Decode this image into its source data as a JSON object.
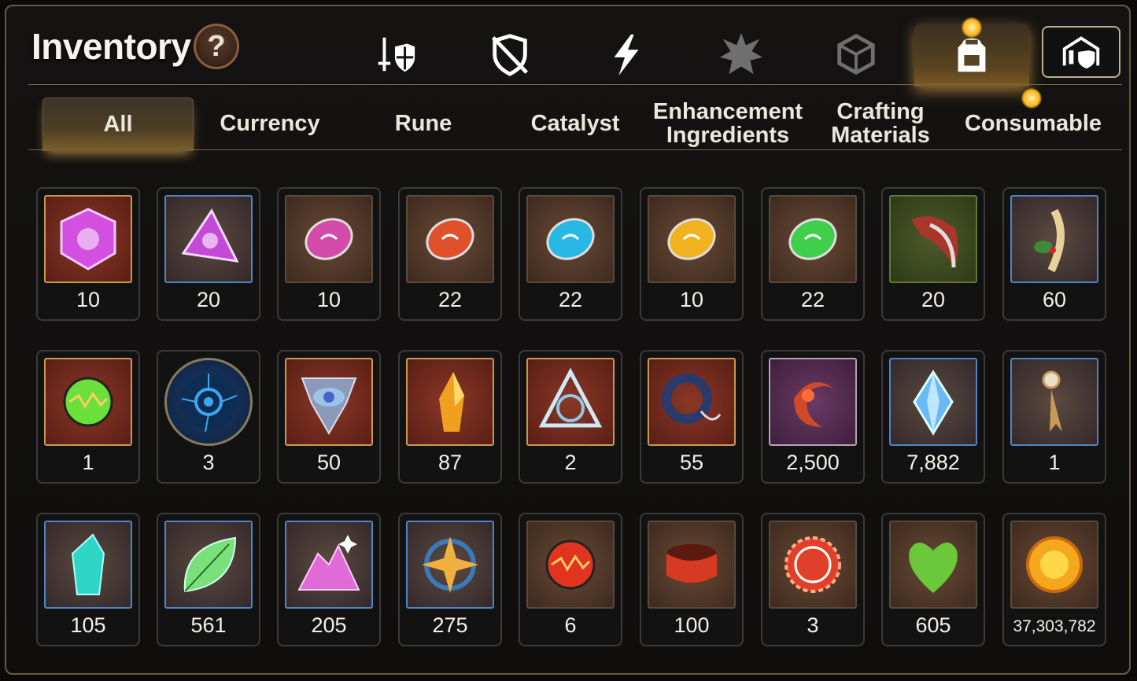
{
  "header": {
    "title": "Inventory",
    "help_label": "?"
  },
  "category_tabs": [
    {
      "name": "tab-equipment",
      "icon": "sword-shield-icon",
      "active": false
    },
    {
      "name": "tab-unequipped",
      "icon": "crossed-shield-icon",
      "active": false
    },
    {
      "name": "tab-skills",
      "icon": "lightning-icon",
      "active": false
    },
    {
      "name": "tab-spirits",
      "icon": "spiked-emblem-icon",
      "active": false
    },
    {
      "name": "tab-boxes",
      "icon": "cube-icon",
      "active": false
    },
    {
      "name": "tab-bag",
      "icon": "backpack-icon",
      "active": true
    }
  ],
  "castle_button": {
    "icon": "castle-shield-icon"
  },
  "sub_tabs": [
    {
      "label": "All",
      "active": true
    },
    {
      "label": "Currency",
      "active": false
    },
    {
      "label": "Rune",
      "active": false
    },
    {
      "label": "Catalyst",
      "active": false
    },
    {
      "label": "Enhancement\nIngredients",
      "active": false
    },
    {
      "label": "Crafting\nMaterials",
      "active": false
    },
    {
      "label": "Consumable",
      "active": false
    }
  ],
  "colors": {
    "accent_gold": "#c69a52",
    "notification": "#ffb21a",
    "frame": "#6b5a3f"
  },
  "items": [
    {
      "icon": "purple-hexagon-gem-icon",
      "quantity": "10",
      "frame": "red",
      "color": "#d24fe0"
    },
    {
      "icon": "purple-triangle-gem-icon",
      "quantity": "20",
      "frame": "blue",
      "color": "#c24ad6"
    },
    {
      "icon": "purple-oval-gem-icon",
      "quantity": "10",
      "frame": "brown",
      "color": "#d44aa8"
    },
    {
      "icon": "red-rune-stone-icon",
      "quantity": "22",
      "frame": "brown",
      "color": "#e0502a"
    },
    {
      "icon": "cyan-rune-stone-icon",
      "quantity": "22",
      "frame": "brown",
      "color": "#27b8e6"
    },
    {
      "icon": "yellow-rune-stone-icon",
      "quantity": "10",
      "frame": "brown",
      "color": "#f0b21e"
    },
    {
      "icon": "green-rune-stone-icon",
      "quantity": "22",
      "frame": "brown",
      "color": "#3fcf4a"
    },
    {
      "icon": "red-claw-icon",
      "quantity": "20",
      "frame": "green",
      "color": "#a8362a"
    },
    {
      "icon": "ginseng-root-icon",
      "quantity": "60",
      "frame": "blue",
      "color": "#e8d09a"
    },
    {
      "icon": "green-orb-icon",
      "quantity": "1",
      "frame": "red",
      "color": "#6ae03a"
    },
    {
      "icon": "blue-circuit-disc-icon",
      "quantity": "3",
      "frame": "round",
      "color": "#3aa8f0"
    },
    {
      "icon": "eye-emblem-icon",
      "quantity": "50",
      "frame": "red",
      "color": "#9fc3e8"
    },
    {
      "icon": "amber-crystal-icon",
      "quantity": "87",
      "frame": "red",
      "color": "#f0a020"
    },
    {
      "icon": "crystal-triquetra-icon",
      "quantity": "2",
      "frame": "red",
      "color": "#cfe8f5"
    },
    {
      "icon": "navy-amulet-icon",
      "quantity": "55",
      "frame": "red",
      "color": "#2a3a6a"
    },
    {
      "icon": "crescent-flower-icon",
      "quantity": "2,500",
      "frame": "purple",
      "color": "#d04a2a"
    },
    {
      "icon": "blue-diamond-icon",
      "quantity": "7,882",
      "frame": "blue",
      "color": "#6ab8f5"
    },
    {
      "icon": "golden-bookmark-icon",
      "quantity": "1",
      "frame": "blue",
      "color": "#c89a5a"
    },
    {
      "icon": "teal-crystal-icon",
      "quantity": "105",
      "frame": "blue",
      "color": "#2fd6c6"
    },
    {
      "icon": "green-leaf-icon",
      "quantity": "561",
      "frame": "blue",
      "color": "#7ae07a"
    },
    {
      "icon": "pink-crystal-pile-icon",
      "quantity": "205",
      "frame": "blue",
      "color": "#e06ad6"
    },
    {
      "icon": "star-amulet-icon",
      "quantity": "275",
      "frame": "blue",
      "color": "#f0b040"
    },
    {
      "icon": "lava-orb-icon",
      "quantity": "6",
      "frame": "brown",
      "color": "#e0341e"
    },
    {
      "icon": "red-bracelet-icon",
      "quantity": "100",
      "frame": "brown",
      "color": "#d63a22"
    },
    {
      "icon": "red-seal-icon",
      "quantity": "3",
      "frame": "brown",
      "color": "#e0402a"
    },
    {
      "icon": "green-heart-icon",
      "quantity": "605",
      "frame": "brown",
      "color": "#6ac83a"
    },
    {
      "icon": "gold-sun-coin-icon",
      "quantity": "37,303,782",
      "frame": "brown",
      "color": "#f5a81e"
    }
  ]
}
